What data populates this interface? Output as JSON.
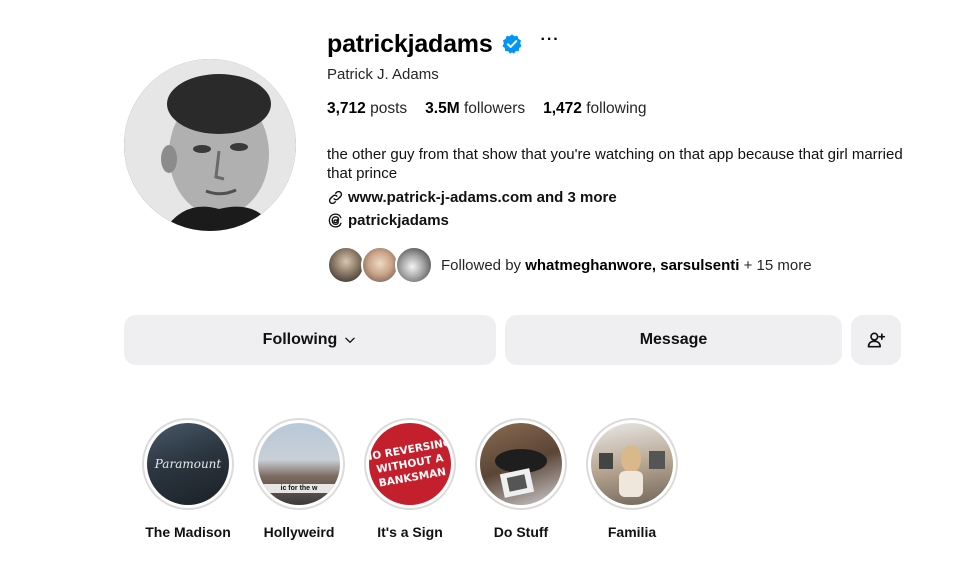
{
  "profile": {
    "username": "patrickjadams",
    "full_name": "Patrick J. Adams",
    "verified": true,
    "more_icon": "···",
    "stats": {
      "posts_count": "3,712",
      "posts_label": "posts",
      "followers_count": "3.5M",
      "followers_label": "followers",
      "following_count": "1,472",
      "following_label": "following"
    },
    "bio": "the other guy from that show that you're watching on that app because that girl married that prince",
    "link_text": "www.patrick-j-adams.com and 3 more",
    "threads_handle": "patrickjadams",
    "followed_by": {
      "prefix": "Followed by",
      "names": "whatmeghanwore, sarsulsenti",
      "suffix": "+ 15 more"
    }
  },
  "actions": {
    "following_label": "Following",
    "message_label": "Message",
    "add_user_icon": "add-user-icon"
  },
  "highlights": [
    {
      "label": "The Madison",
      "image_text": "Paramount"
    },
    {
      "label": "Hollyweird",
      "image_text": "ic for the w"
    },
    {
      "label": "It's a Sign",
      "image_text": "NO REVERSING WITHOUT A BANKSMAN"
    },
    {
      "label": "Do Stuff"
    },
    {
      "label": "Familia"
    }
  ],
  "colors": {
    "verified_blue": "#0095f6",
    "button_bg": "#efeff1",
    "ring": "#dbdbdb"
  }
}
